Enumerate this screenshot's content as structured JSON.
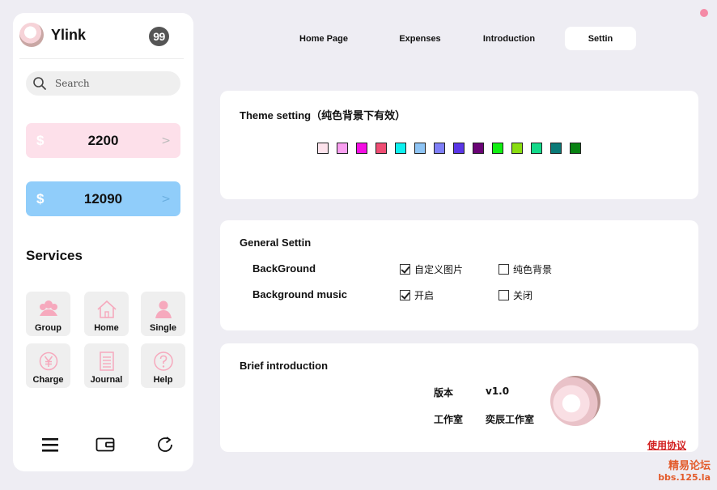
{
  "app": {
    "name": "Ylink",
    "badge": "99"
  },
  "search": {
    "placeholder": "Search"
  },
  "balances": [
    {
      "currency": "$",
      "amount": "2200",
      "arrow": ">"
    },
    {
      "currency": "$",
      "amount": "12090",
      "arrow": ">"
    }
  ],
  "services": {
    "title": "Services",
    "items": [
      {
        "label": "Group",
        "icon": "group-icon"
      },
      {
        "label": "Home",
        "icon": "home-icon"
      },
      {
        "label": "Single",
        "icon": "single-user-icon"
      },
      {
        "label": "Charge",
        "icon": "yen-coin-icon"
      },
      {
        "label": "Journal",
        "icon": "journal-icon"
      },
      {
        "label": "Help",
        "icon": "help-icon"
      }
    ]
  },
  "nav": {
    "tabs": [
      {
        "label": "Home Page"
      },
      {
        "label": "Expenses"
      },
      {
        "label": "Introduction"
      },
      {
        "label": "Settin",
        "active": true
      }
    ]
  },
  "theme": {
    "title": "Theme setting（纯色背景下有效）",
    "swatches": [
      "#fde3ec",
      "#f99ff0",
      "#f40ee3",
      "#ef4d73",
      "#0ef0ef",
      "#8ec4f4",
      "#7f7ff7",
      "#5a36e6",
      "#6a0476",
      "#11ef11",
      "#8add11",
      "#13d98a",
      "#0a7a78",
      "#088212"
    ]
  },
  "general": {
    "title": "General Settin",
    "background": {
      "label": "BackGround",
      "opt1": "自定义图片",
      "opt1_checked": true,
      "opt2": "纯色背景",
      "opt2_checked": false
    },
    "music": {
      "label": "Background music",
      "opt1": "开启",
      "opt1_checked": true,
      "opt2": "关闭",
      "opt2_checked": false
    }
  },
  "intro": {
    "title": "Brief introduction",
    "version_label": "版本",
    "version_value": "v1.0",
    "studio_label": "工作室",
    "studio_value": "奕辰工作室",
    "terms_link": "使用协议"
  },
  "watermark": {
    "line1": "精易论坛",
    "line2": "bbs.125.la"
  },
  "colors": {
    "accent_pink": "#fde0ea",
    "accent_blue": "#90cdfa",
    "link_red": "#d21f1f"
  }
}
